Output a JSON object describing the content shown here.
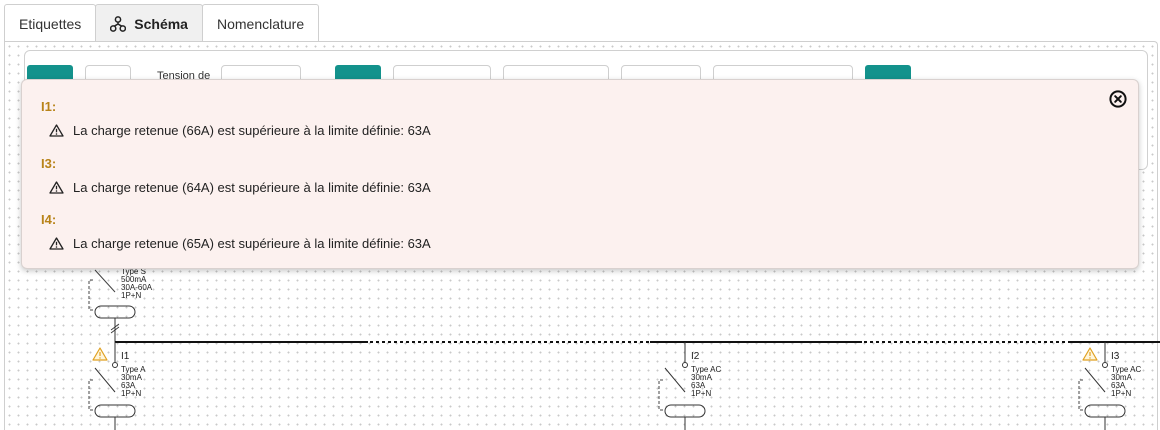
{
  "tabs": [
    {
      "label": "Etiquettes",
      "active": false
    },
    {
      "label": "Schéma",
      "active": true,
      "icon": "schema-network-icon"
    },
    {
      "label": "Nomenclature",
      "active": false
    }
  ],
  "toolbar": {
    "tension_label": "Tension de"
  },
  "alert": {
    "close_icon": "close-circle-icon",
    "items": [
      {
        "title": "I1:",
        "message": "La charge retenue (66A) est supérieure à la limite définie: 63A"
      },
      {
        "title": "I3:",
        "message": "La charge retenue (64A) est supérieure à la limite définie: 63A"
      },
      {
        "title": "I4:",
        "message": "La charge retenue (65A) est supérieure à la limite définie: 63A"
      }
    ]
  },
  "schema": {
    "head_device": {
      "specs": "Type S\n500mA\n30A-60A\n1P+N"
    },
    "circuits": [
      {
        "id": "I1",
        "warning": true,
        "specs": "Type A\n30mA\n63A\n1P+N"
      },
      {
        "id": "I2",
        "warning": false,
        "specs": "Type AC\n30mA\n63A\n1P+N"
      },
      {
        "id": "I3",
        "warning": true,
        "specs": "Type AC\n30mA\n63A\n1P+N"
      }
    ]
  },
  "colors": {
    "accent": "#13928c",
    "warning_title": "#b88318",
    "alert_bg": "#fcf1ef",
    "warning_icon": "#e0a020"
  }
}
